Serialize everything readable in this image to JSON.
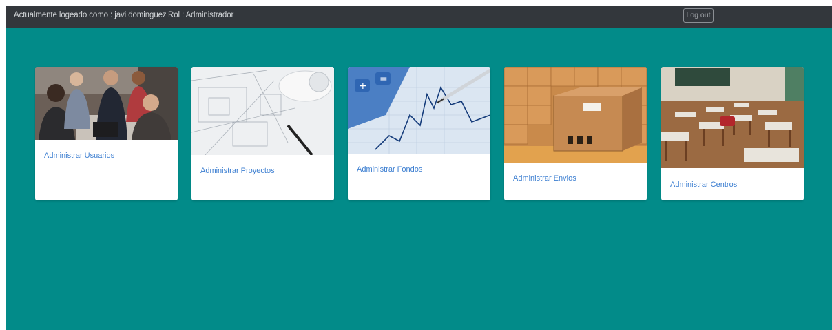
{
  "navbar": {
    "user_text": "Actualmente logeado como : javi dominguez",
    "role_text": "Rol : Administrador",
    "logout_label": "Log out"
  },
  "cards": [
    {
      "label": "Administrar Usuarios",
      "image": "business-team-photo"
    },
    {
      "label": "Administrar Proyectos",
      "image": "architectural-blueprints-photo"
    },
    {
      "label": "Administrar Fondos",
      "image": "calculator-financial-chart-photo"
    },
    {
      "label": "Administrar Envios",
      "image": "cardboard-boxes-photo"
    },
    {
      "label": "Administrar Centros",
      "image": "classroom-desks-photo"
    }
  ],
  "colors": {
    "background": "#028b89",
    "navbar": "#33373c",
    "link": "#3d7fd1"
  }
}
